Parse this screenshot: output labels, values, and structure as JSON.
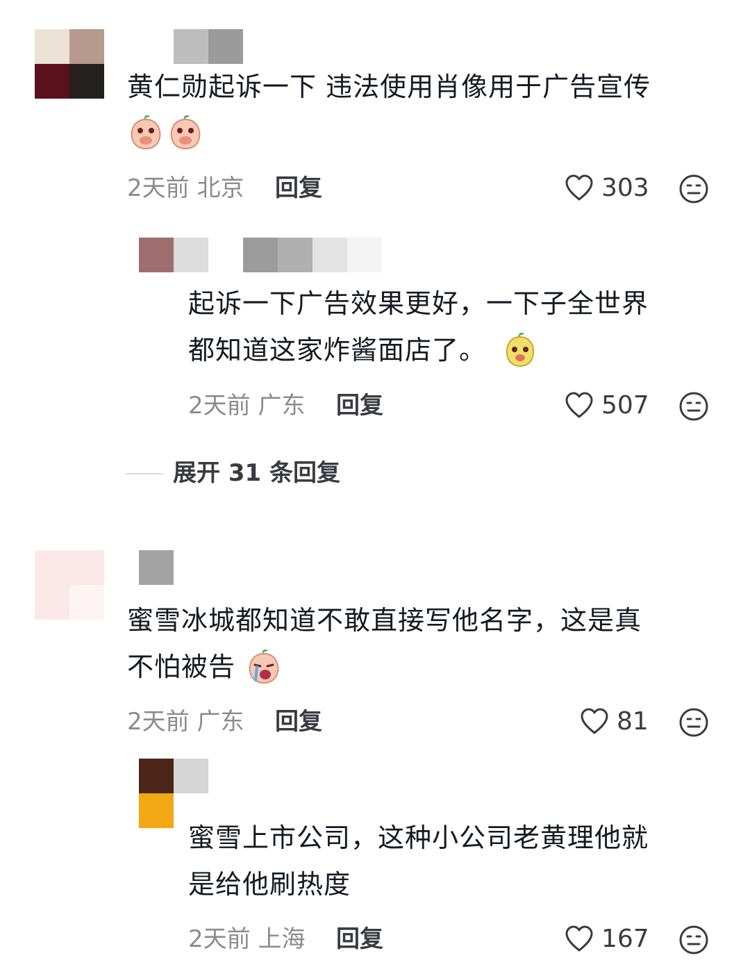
{
  "comments": [
    {
      "text_line1": "黄仁勋起诉一下 违法使用肖像用于广告宣传",
      "time": "2天前",
      "location": "北京",
      "reply_label": "回复",
      "likes": "303",
      "reply": {
        "text_line1": "起诉一下广告效果更好，一下子全世界",
        "text_line2": "都知道这家炸酱面店了。",
        "time": "2天前",
        "location": "广东",
        "reply_label": "回复",
        "likes": "507"
      },
      "expand_label": "展开 31 条回复"
    },
    {
      "text_line1": "蜜雪冰城都知道不敢直接写他名字，这是真",
      "text_line2": "不怕被告",
      "time": "2天前",
      "location": "广东",
      "reply_label": "回复",
      "likes": "81",
      "reply": {
        "text_line1": "蜜雪上市公司，这种小公司老黄理他就",
        "text_line2": "是给他刷热度",
        "time": "2天前",
        "location": "上海",
        "reply_label": "回复",
        "likes": "167"
      }
    }
  ],
  "icons": {
    "like": "heart-outline-icon",
    "dislike": "meh-face-icon",
    "emoji_peach": "peach-cover-mouth-emoji",
    "emoji_yellow": "yellow-smirk-emoji",
    "emoji_crying": "peach-crying-emoji"
  },
  "colors": {
    "text": "#161823",
    "meta": "#8a8b91",
    "reply": "#3a3b42"
  }
}
